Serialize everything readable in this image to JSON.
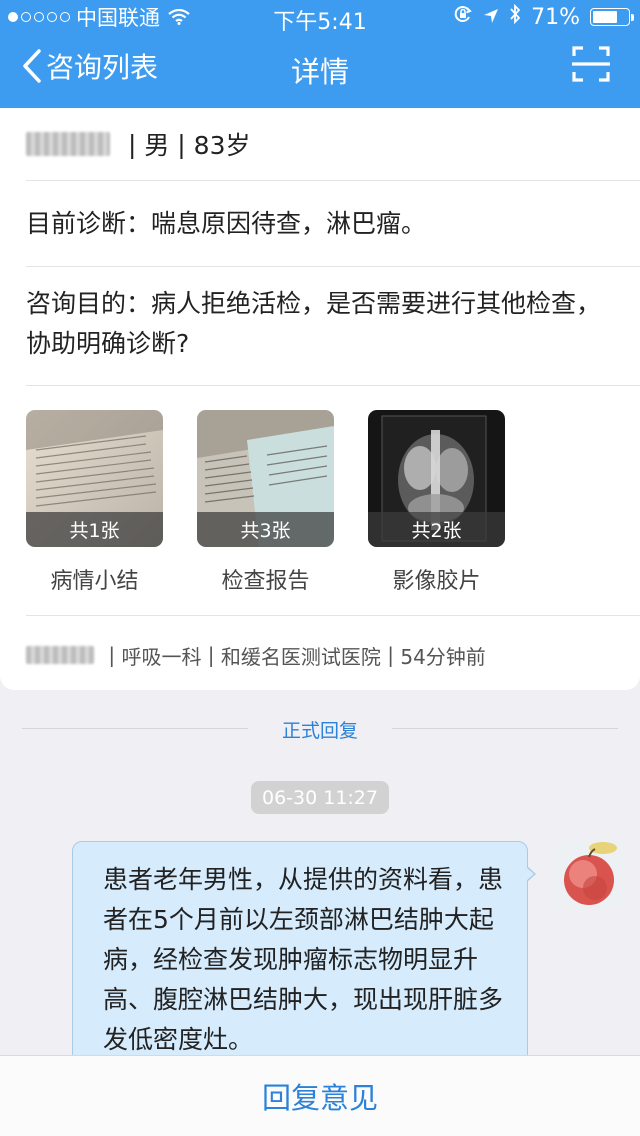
{
  "status_bar": {
    "carrier": "中国联通",
    "time": "下午5:41",
    "battery_percent": "71%",
    "battery_level": 0.71,
    "signal_bars_filled": 1,
    "signal_bars_total": 5
  },
  "nav": {
    "back_label": "咨询列表",
    "title": "详情"
  },
  "patient": {
    "gender": "男",
    "age": "83岁",
    "separator": " | "
  },
  "diagnosis": "目前诊断：喘息原因待查，淋巴瘤。",
  "purpose": "咨询目的：病人拒绝活检，是否需要进行其他检查，协助明确诊断?",
  "attachments": [
    {
      "count": "共1张",
      "label": "病情小结",
      "kind": "document"
    },
    {
      "count": "共3张",
      "label": "检查报告",
      "kind": "report"
    },
    {
      "count": "共2张",
      "label": "影像胶片",
      "kind": "xray"
    }
  ],
  "meta": {
    "department": "呼吸一科",
    "hospital": "和缓名医测试医院",
    "time_ago": "54分钟前"
  },
  "reply": {
    "section_label": "正式回复",
    "timestamp": "06-30 11:27",
    "message": "患者老年男性，从提供的资料看，患者在5个月前以左颈部淋巴结肿大起病，经检查发现肿瘤标志物明显升高、腹腔淋巴结肿大，现出现肝脏多发低密度灶。"
  },
  "bottom_button": "回复意见",
  "colors": {
    "header": "#3d9bf0",
    "link": "#2b82d9",
    "bubble": "#d6ebfc"
  }
}
